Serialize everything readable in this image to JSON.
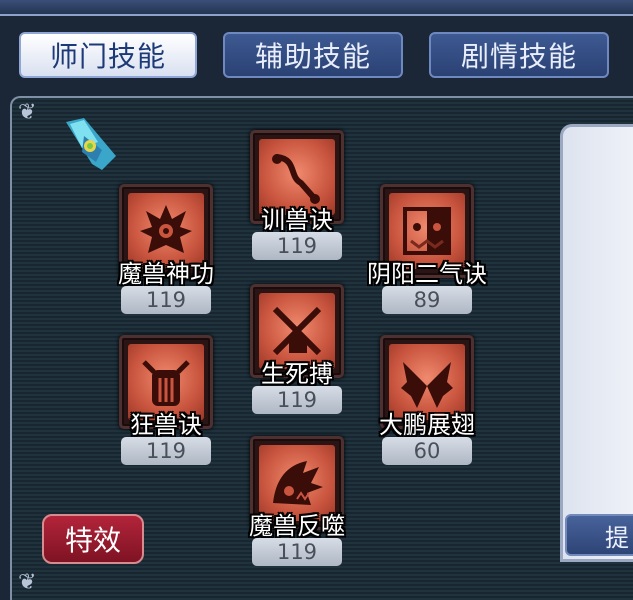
{
  "tabs": [
    {
      "label": "师门技能",
      "active": true
    },
    {
      "label": "辅助技能",
      "active": false
    },
    {
      "label": "剧情技能",
      "active": false
    }
  ],
  "skills": [
    {
      "name": "训兽诀",
      "level": "119",
      "icon": "whip-icon"
    },
    {
      "name": "魔兽神功",
      "level": "119",
      "icon": "demon-crown-icon"
    },
    {
      "name": "阴阳二气诀",
      "level": "89",
      "icon": "yin-yang-beast-icon"
    },
    {
      "name": "生死搏",
      "level": "119",
      "icon": "crossed-blades-icon"
    },
    {
      "name": "狂兽诀",
      "level": "119",
      "icon": "horned-beast-icon"
    },
    {
      "name": "大鹏展翅",
      "level": "60",
      "icon": "wings-icon"
    },
    {
      "name": "魔兽反噬",
      "level": "119",
      "icon": "beast-bite-icon"
    }
  ],
  "effects_button": "特效",
  "hint_button": "提",
  "colors": {
    "accent": "#b3243a",
    "icon_bg": "#d9664c",
    "level_bg": "#c4cbd6"
  }
}
